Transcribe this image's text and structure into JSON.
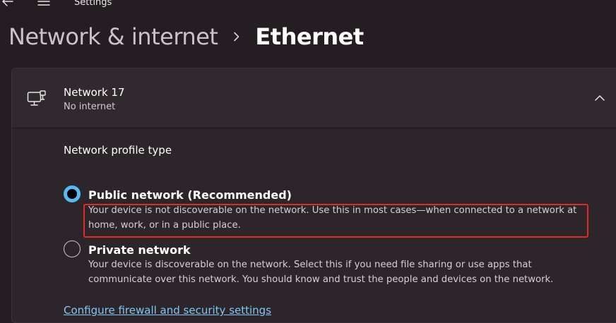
{
  "window": {
    "title": "Settings",
    "back_icon": "arrow-left-icon",
    "menu_icon": "hamburger-menu-icon"
  },
  "breadcrumb": {
    "parent": "Network & internet",
    "separator_icon": "chevron-right-icon",
    "current": "Ethernet"
  },
  "network": {
    "icon": "ethernet-icon",
    "name": "Network 17",
    "status": "No internet",
    "expander_icon": "chevron-up-icon"
  },
  "profile": {
    "heading": "Network profile type",
    "options": [
      {
        "label": "Public network (Recommended)",
        "description": "Your device is not discoverable on the network. Use this in most cases—when connected to a network at home, work, or in a public place.",
        "selected": true
      },
      {
        "label": "Private network",
        "description": "Your device is discoverable on the network. Select this if you need file sharing or use apps that communicate over this network. You should know and trust the people and devices on the network.",
        "selected": false
      }
    ]
  },
  "links": {
    "firewall": "Configure firewall and security settings"
  },
  "colors": {
    "accent": "#57b9f5",
    "link": "#80c7f7",
    "highlight": "#e22a2a",
    "background": "#241d22",
    "card": "#2c2529"
  }
}
